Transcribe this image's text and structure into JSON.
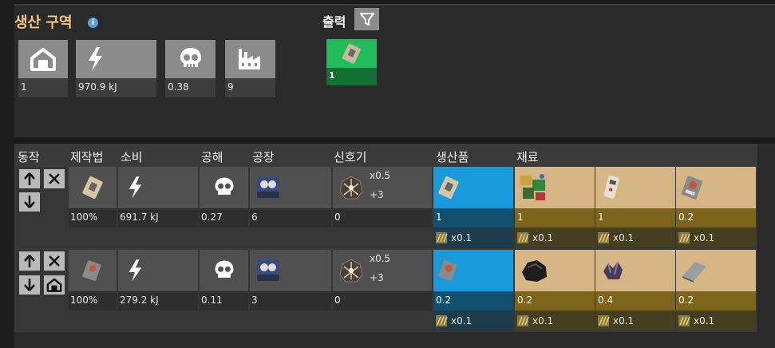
{
  "section": {
    "title": "생산 구역"
  },
  "summary": {
    "buildings": "1",
    "energy": "970.9 kJ",
    "pollution": "0.38",
    "factories": "9"
  },
  "output": {
    "label": "출력",
    "item_count": "1"
  },
  "headers": {
    "actions": "동작",
    "recipe": "제작법",
    "consumption": "소비",
    "pollution": "공해",
    "factory": "공장",
    "beacon": "신호기",
    "products": "생산품",
    "ingredients": "재료"
  },
  "rows": [
    {
      "recipe_pct": "100%",
      "energy": "691.7 kJ",
      "pollution": "0.27",
      "factory_count": "6",
      "beacon_count": "0",
      "beacon_mult1": "x0.5",
      "beacon_mult2": "+3",
      "product_value": "1",
      "product_mult": "x0.1",
      "ingredients": [
        {
          "value": "1",
          "mult": "x0.1"
        },
        {
          "value": "1",
          "mult": "x0.1"
        },
        {
          "value": "0.2",
          "mult": "x0.1"
        }
      ]
    },
    {
      "recipe_pct": "100%",
      "energy": "279.2 kJ",
      "pollution": "0.11",
      "factory_count": "3",
      "beacon_count": "0",
      "beacon_mult1": "x0.5",
      "beacon_mult2": "+3",
      "product_value": "0.2",
      "product_mult": "x0.1",
      "ingredients": [
        {
          "value": "0.2",
          "mult": "x0.1"
        },
        {
          "value": "0.4",
          "mult": "x0.1"
        },
        {
          "value": "0.2",
          "mult": "x0.1"
        }
      ]
    }
  ]
}
